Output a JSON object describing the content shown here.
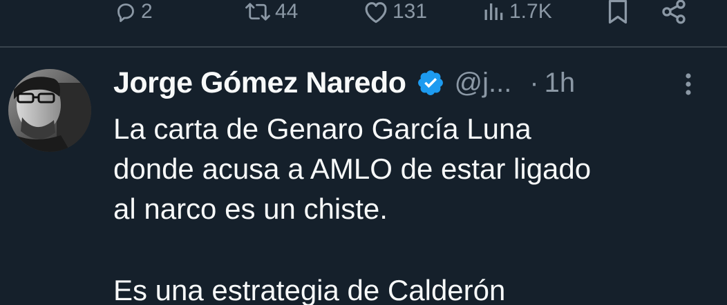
{
  "actions": {
    "replies": "2",
    "retweets": "44",
    "likes": "131",
    "views": "1.7K"
  },
  "tweet": {
    "display_name": "Jorge Gómez Naredo",
    "handle": "@j...",
    "separator": "·",
    "time": "1h",
    "text_lines": [
      "La carta de Genaro García Luna",
      "donde acusa a AMLO de estar ligado",
      "al narco es un chiste."
    ],
    "text_cut_line": "Es una estrategia de Calderón"
  },
  "colors": {
    "background": "#15202b",
    "text": "#f7f9f9",
    "secondary": "#8b98a5",
    "verified": "#1d9bf0",
    "divider": "#38444d"
  },
  "icons": {
    "reply": "reply-icon",
    "retweet": "retweet-icon",
    "like": "like-icon",
    "views": "views-icon",
    "bookmark": "bookmark-icon",
    "share": "share-icon",
    "verified": "verified-badge-icon",
    "more": "more-options-icon"
  }
}
